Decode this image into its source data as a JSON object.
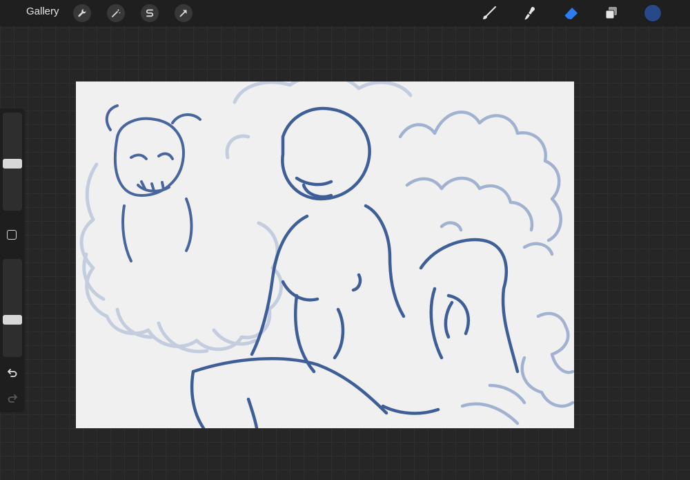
{
  "app": {
    "gallery_label": "Gallery"
  },
  "toolbar_left": {
    "icons": [
      "wrench-icon",
      "magic-wand-icon",
      "selection-s-icon",
      "transform-arrow-icon"
    ]
  },
  "toolbar_right": {
    "icons": [
      "brush-icon",
      "smudge-icon",
      "eraser-icon",
      "layers-icon"
    ],
    "active_tool": "eraser",
    "active_tool_color": "#2d7cf0",
    "current_color": "#27498a"
  },
  "sidebar": {
    "brush_size": 0.48,
    "brush_opacity": 0.37
  },
  "canvas": {
    "background": "#f0f0f1",
    "stroke_color": "#2b4f8f"
  }
}
